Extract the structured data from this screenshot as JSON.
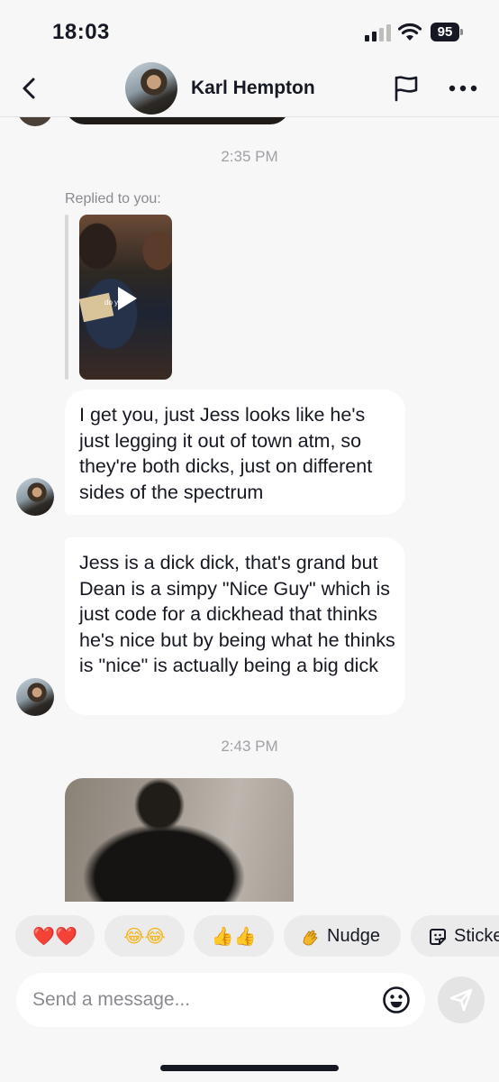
{
  "status_bar": {
    "time": "18:03",
    "battery": "95"
  },
  "header": {
    "contact_name": "Karl Hempton",
    "back_icon": "chevron-left-icon",
    "flag_icon": "flag-icon",
    "more_icon": "more-horizontal-icon"
  },
  "chat": {
    "timestamps": [
      "2:35 PM",
      "2:43 PM"
    ],
    "reply_label": "Replied to you:",
    "reply_video_caption": "do y",
    "messages": [
      {
        "sender": "Karl Hempton",
        "text": "I get you, just Jess looks like he's just legging it out of town atm, so they're both dicks, just on different sides of the spectrum"
      },
      {
        "sender": "Karl Hempton",
        "text": "Jess is a dick dick, that's grand but Dean is a simpy \"Nice Guy\" which is just code for a dickhead that thinks he's nice but by being what he thinks is \"nice\" is actually being a big dick"
      }
    ]
  },
  "quick_replies": [
    {
      "label": "❤️❤️",
      "icon": "hearts-emoji"
    },
    {
      "label": "😂😂",
      "icon": "laughing-emoji"
    },
    {
      "label": "👍👍",
      "icon": "thumbs-up-emoji"
    },
    {
      "label": "Nudge",
      "icon": "waving-hand-icon"
    },
    {
      "label": "Sticke",
      "icon": "sticker-icon"
    }
  ],
  "composer": {
    "placeholder": "Send a message...",
    "emoji_icon": "smiley-icon",
    "send_icon": "send-icon"
  },
  "colors": {
    "background": "#f7f7f7",
    "bubble": "#ffffff",
    "text": "#161823",
    "muted": "#a0a0a6",
    "chip": "#ebebeb"
  }
}
